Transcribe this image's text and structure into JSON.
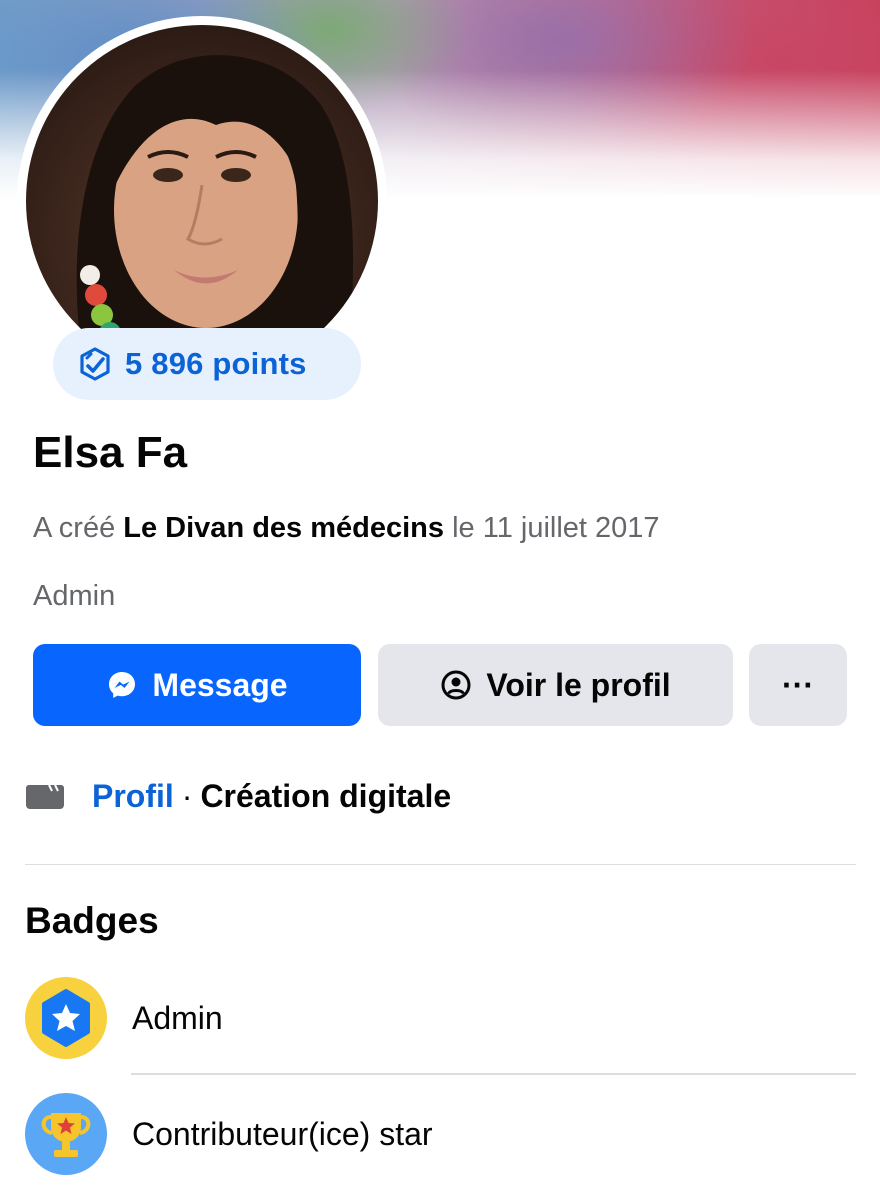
{
  "profile": {
    "name": "Elsa Fa",
    "points_label": "5 896 points",
    "created_prefix": "A créé",
    "group_name": "Le Divan des médecins",
    "created_date": "le 11 juillet 2017",
    "role": "Admin"
  },
  "actions": {
    "message_label": "Message",
    "view_profile_label": "Voir le profil",
    "more_label": "···"
  },
  "profile_info": {
    "link_label": "Profil",
    "separator": "·",
    "category": "Création digitale"
  },
  "badges": {
    "title": "Badges",
    "items": [
      {
        "label": "Admin",
        "icon": "admin-star-badge-icon",
        "bg_color": "#f7d23e"
      },
      {
        "label": "Contributeur(ice) star",
        "icon": "trophy-badge-icon",
        "bg_color": "#5aa7f5"
      }
    ]
  },
  "colors": {
    "accent": "#0866ff",
    "link": "#0b63d6",
    "secondary_button": "#e4e6eb",
    "muted_text": "#65676b"
  }
}
